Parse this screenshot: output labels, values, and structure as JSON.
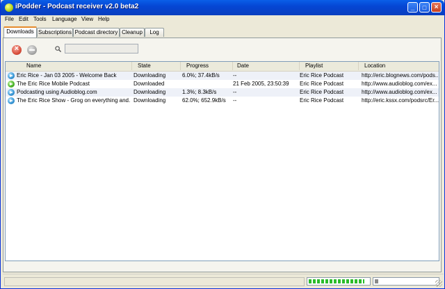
{
  "window": {
    "title": "iPodder - Podcast receiver v2.0 beta2",
    "controls": {
      "minimize": "_",
      "maximize": "□",
      "close": "×"
    }
  },
  "menu": [
    "File",
    "Edit",
    "Tools",
    "Language",
    "View",
    "Help"
  ],
  "tabs": [
    "Downloads",
    "Subscriptions",
    "Podcast directory",
    "Cleanup",
    "Log"
  ],
  "active_tab": "Downloads",
  "toolbar": {
    "cancel_icon": "cancel-icon",
    "remove_icon": "remove-icon",
    "search_icon": "search-icon",
    "search_value": ""
  },
  "table": {
    "columns": [
      "Name",
      "State",
      "Progress",
      "Date",
      "Playlist",
      "Location"
    ],
    "rows": [
      {
        "status": "downloading",
        "name": "Eric Rice - Jan 03 2005 - Welcome Back",
        "state": "Downloading",
        "progress": "6.0%; 37.4kB/s",
        "date": "--",
        "playlist": "Eric Rice Podcast",
        "location": "http://eric.blognews.com/pods..."
      },
      {
        "status": "downloaded",
        "name": "The Eric Rice Mobile Podcast",
        "state": "Downloaded",
        "progress": "",
        "date": "21 Feb 2005, 23:50:39",
        "playlist": "Eric Rice Podcast",
        "location": "http://www.audioblog.com/ex..."
      },
      {
        "status": "downloading",
        "name": "Podcasting using Audioblog.com",
        "state": "Downloading",
        "progress": "1.3%; 8.3kB/s",
        "date": "--",
        "playlist": "Eric Rice Podcast",
        "location": "http://www.audioblog.com/ex..."
      },
      {
        "status": "downloading",
        "name": "The Eric Rice Show - Grog on everything and...",
        "state": "Downloading",
        "progress": "62.0%; 652.9kB/s",
        "date": "--",
        "playlist": "Eric Rice Podcast",
        "location": "http://eric.kssx.com/podsrc/Er..."
      }
    ]
  },
  "statusbar": {
    "text": "",
    "progress_fraction": 0.93,
    "secondary_fraction": 0.05
  },
  "colors": {
    "title_bar": "#0546d4",
    "active_tab_accent": "#e68b2c",
    "progress_green": "#2bbb2b"
  }
}
